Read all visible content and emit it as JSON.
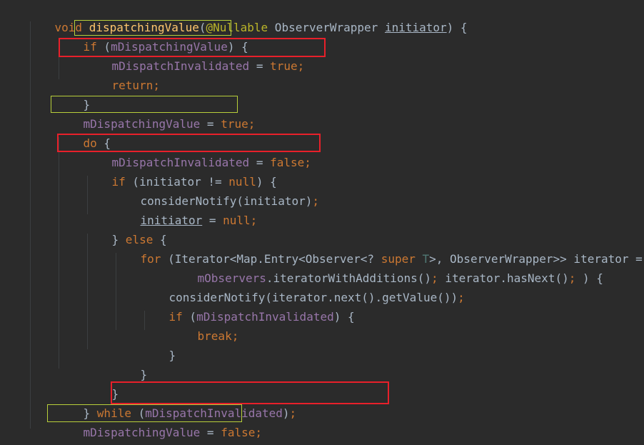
{
  "code": {
    "signature": {
      "kw_void": "void",
      "method_name": "dispatchingValue",
      "open_paren": "(",
      "annotation": "@Nullable",
      "param_type": " ObserverWrapper ",
      "param_name": "initiator",
      "close": ") {"
    },
    "if1": {
      "kw": "if",
      "open": " (",
      "field": "mDispatchingValue",
      "close": ") {"
    },
    "assign_invalidated_true": {
      "field": "mDispatchInvalidated",
      "op": " = ",
      "value": "true",
      "semi": ";"
    },
    "return": {
      "kw": "return",
      "semi": ";"
    },
    "close_if1": "}",
    "assign_dispatching_true": {
      "field": "mDispatchingValue",
      "op": " = ",
      "value": "true",
      "semi": ";"
    },
    "do_line": {
      "kw": "do",
      "rest": " {"
    },
    "assign_invalidated_false": {
      "field": "mDispatchInvalidated",
      "op": " = ",
      "value": "false",
      "semi": ";"
    },
    "if_initiator": {
      "kw": "if",
      "mid": " (initiator != ",
      "null": "null",
      "close": ") {"
    },
    "consider_initiator": {
      "text": "considerNotify(initiator)",
      "semi": ";"
    },
    "initiator_null": {
      "var": "initiator",
      "op": " = ",
      "null": "null",
      "semi": ";"
    },
    "else_line": {
      "brace": "} ",
      "kw": "else",
      "rest": " {"
    },
    "for_line": {
      "kw": "for",
      "a": " (Iterator<Map.Entry<Observer<? ",
      "super": "super",
      "sp": " ",
      "t": "T",
      "b": ">, ObserverWrapper>> iterator ="
    },
    "for_cont": {
      "field": "mObservers",
      "a": ".iteratorWithAdditions()",
      "semi1": ";",
      "b": " iterator.hasNext()",
      "semi2": ";",
      "c": " ) {"
    },
    "consider_iterator": {
      "text": "considerNotify(iterator.next().getValue())",
      "semi": ";"
    },
    "if_invalidated": {
      "kw": "if",
      "open": " (",
      "field": "mDispatchInvalidated",
      "close": ") {"
    },
    "break": {
      "kw": "break",
      "semi": ";"
    },
    "close_brace": "}",
    "while_line": {
      "brace": "} ",
      "kw": "while",
      "open": " (",
      "field": "mDispatchInvalidated",
      "close": ")",
      "semi": ";"
    },
    "assign_dispatching_false": {
      "field": "mDispatchingValue",
      "op": " = ",
      "value": "false",
      "semi": ";"
    },
    "method_close": "}"
  },
  "highlight_colors": {
    "red_box": "#e8202a",
    "yellow_box": "#b8cf3a"
  }
}
